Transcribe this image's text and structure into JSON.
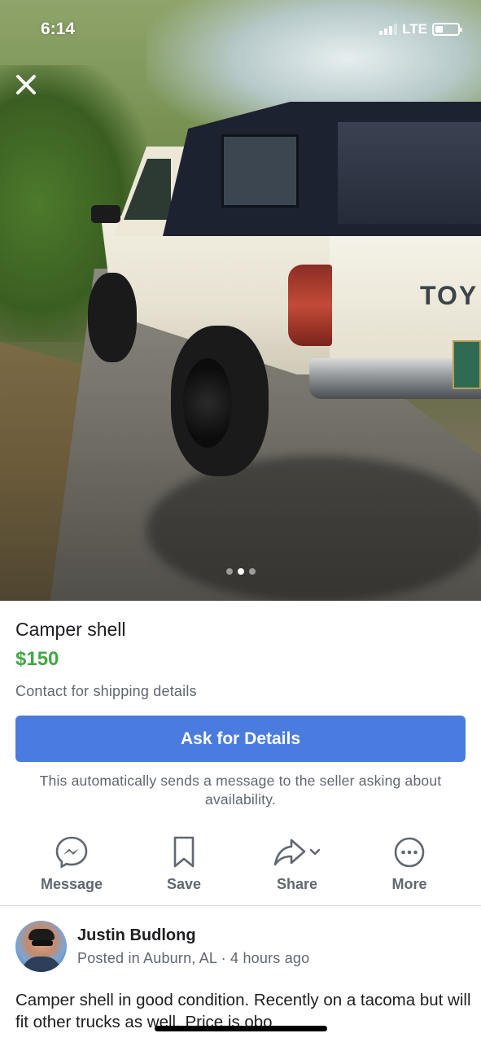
{
  "status_bar": {
    "time": "6:14",
    "network": "LTE",
    "signal_bars": 4,
    "signal_bars_filled": 3,
    "battery_level_fraction": 0.25
  },
  "photo": {
    "pager_count": 3,
    "pager_active": 2,
    "close_icon": "close-icon",
    "visible_text": "TOY"
  },
  "listing": {
    "title": "Camper shell",
    "price": "$150",
    "shipping": "Contact for shipping details",
    "ask_button": "Ask for Details",
    "ask_note": "This automatically sends a message to the seller asking about availability.",
    "price_color": "#42a745",
    "accent_color": "#4a7ce0"
  },
  "actions": [
    {
      "label": "Message",
      "icon": "messenger-icon"
    },
    {
      "label": "Save",
      "icon": "bookmark-icon"
    },
    {
      "label": "Share",
      "icon": "share-icon"
    },
    {
      "label": "More",
      "icon": "more-icon"
    }
  ],
  "seller": {
    "name": "Justin Budlong",
    "meta": "Posted in Auburn, AL · 4 hours ago"
  },
  "description": "Camper shell in good condition. Recently on a tacoma but will fit other trucks as well. Price is obo"
}
